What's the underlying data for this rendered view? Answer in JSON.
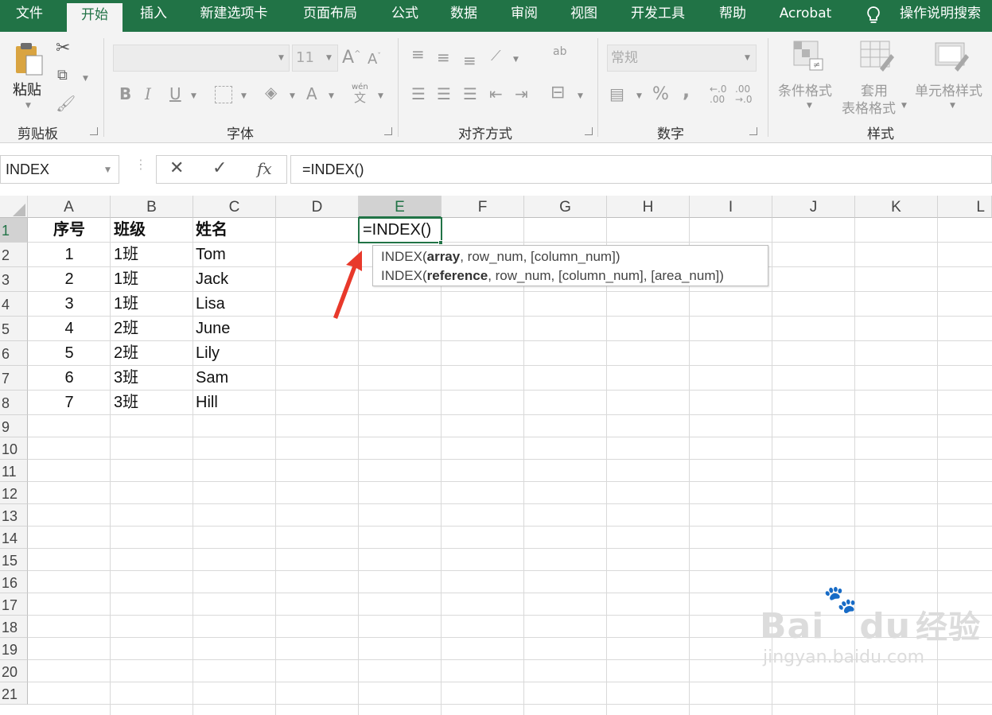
{
  "tabs": [
    "文件",
    "开始",
    "插入",
    "新建选项卡",
    "页面布局",
    "公式",
    "数据",
    "审阅",
    "视图",
    "开发工具",
    "帮助",
    "Acrobat"
  ],
  "tell_me": "操作说明搜索",
  "ribbon": {
    "clipboard": {
      "paste": "粘贴",
      "label": "剪贴板"
    },
    "font": {
      "size": "11",
      "bold": "B",
      "italic": "I",
      "underline": "U",
      "font_color_glyph": "A",
      "wen": "wén",
      "wen_char": "文",
      "label": "字体"
    },
    "alignment": {
      "label": "对齐方式",
      "wrap_glyph": "ab"
    },
    "number": {
      "format": "常规",
      "percent": "%",
      "comma": ",",
      "inc_dec": "←.0\n.00",
      "dec_dec": ".00\n→.0",
      "label": "数字"
    },
    "styles": {
      "cond_format": "条件格式",
      "table_format_1": "套用",
      "table_format_2": "表格格式",
      "cell_styles": "单元格样式",
      "label": "样式"
    }
  },
  "name_box": "INDEX",
  "fx": "fx",
  "formula": "=INDEX()",
  "columns": [
    "A",
    "B",
    "C",
    "D",
    "E",
    "F",
    "G",
    "H",
    "I",
    "J",
    "K",
    "L"
  ],
  "rows": [
    "1",
    "2",
    "3",
    "4",
    "5",
    "6",
    "7",
    "8",
    "9",
    "10",
    "11",
    "12",
    "13",
    "14",
    "15",
    "16",
    "17",
    "18",
    "19",
    "20",
    "21"
  ],
  "headers": {
    "a": "序号",
    "b": "班级",
    "c": "姓名"
  },
  "data_rows": [
    {
      "a": "1",
      "b": "1班",
      "c": "Tom"
    },
    {
      "a": "2",
      "b": "1班",
      "c": "Jack"
    },
    {
      "a": "3",
      "b": "1班",
      "c": "Lisa"
    },
    {
      "a": "4",
      "b": "2班",
      "c": "June"
    },
    {
      "a": "5",
      "b": "2班",
      "c": "Lily"
    },
    {
      "a": "6",
      "b": "3班",
      "c": "Sam"
    },
    {
      "a": "7",
      "b": "3班",
      "c": "Hill"
    }
  ],
  "active_cell_text": "=INDEX()",
  "tooltip": {
    "line1": {
      "fn": "INDEX(",
      "arg": "array",
      "rest": ", row_num, [column_num])"
    },
    "line2": {
      "fn": "INDEX(",
      "arg": "reference",
      "rest": ", row_num, [column_num], [area_num])"
    }
  },
  "watermark": {
    "logo": "Bai",
    "logo2": "du",
    "suffix": "经验",
    "url": "jingyan.baidu.com"
  },
  "colors": {
    "accent": "#217346",
    "arrow": "#e8392b"
  }
}
